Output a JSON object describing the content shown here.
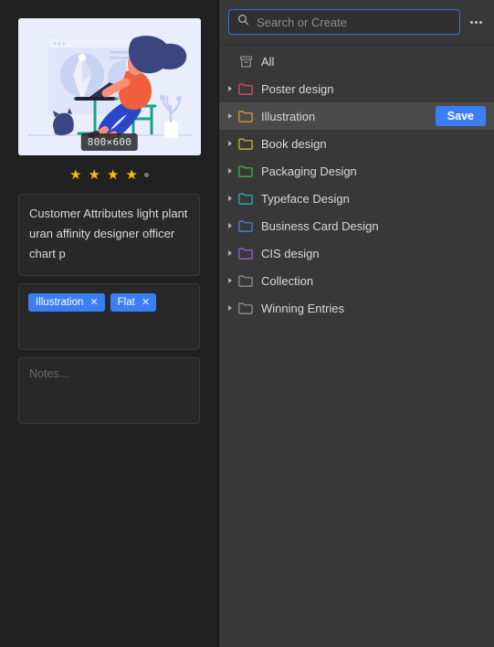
{
  "left": {
    "thumbnail": {
      "name": "preview-thumbnail",
      "dimensions_badge": "800×600",
      "alt": "flat illustration of a person with navy hair in an orange shirt sitting on a stool working on a laptop, browser window with pen-tool and pie chart behind, a cat and a potted plant nearby"
    },
    "rating": {
      "name": "star-rating",
      "filled": 4,
      "total": 4,
      "filled_color": "#fbb912",
      "has_clear_dot": true
    },
    "description": {
      "label": "description",
      "value": "Customer Attributes light plant uran affinity designer officer chart p"
    },
    "tags": {
      "label": "tags",
      "items": [
        {
          "label": "Illustration",
          "remove_glyph": "✕"
        },
        {
          "label": "Flat",
          "remove_glyph": "✕"
        }
      ],
      "tag_color": "#3b7ef6"
    },
    "notes": {
      "label": "notes",
      "value": "",
      "placeholder": "Notes..."
    }
  },
  "right": {
    "search": {
      "placeholder": "Search or Create",
      "value": "",
      "icon": "search-icon",
      "focused": true,
      "focus_color": "#3c6fe0"
    },
    "more_menu": {
      "name": "more-options-button",
      "icon": "ellipsis-icon"
    },
    "folders": [
      {
        "label": "All",
        "icon": "archive-box-icon",
        "color": "#9a9a9a",
        "twisty": false,
        "selected": false,
        "action": null
      },
      {
        "label": "Poster design",
        "icon": "folder-icon",
        "color": "#e05263",
        "twisty": true,
        "selected": false,
        "action": null
      },
      {
        "label": "Illustration",
        "icon": "folder-icon",
        "color": "#e8a33d",
        "twisty": true,
        "selected": true,
        "action": "Save"
      },
      {
        "label": "Book design",
        "icon": "folder-icon",
        "color": "#d8c230",
        "twisty": true,
        "selected": false,
        "action": null
      },
      {
        "label": "Packaging Design",
        "icon": "folder-icon",
        "color": "#3fbf53",
        "twisty": true,
        "selected": false,
        "action": null
      },
      {
        "label": "Typeface Design",
        "icon": "folder-icon",
        "color": "#2fb6c4",
        "twisty": true,
        "selected": false,
        "action": null
      },
      {
        "label": "Business Card Design",
        "icon": "folder-icon",
        "color": "#4f8ae0",
        "twisty": true,
        "selected": false,
        "action": null
      },
      {
        "label": "CIS design",
        "icon": "folder-icon",
        "color": "#a766d8",
        "twisty": true,
        "selected": false,
        "action": null
      },
      {
        "label": "Collection",
        "icon": "folder-icon",
        "color": "#9a9a9a",
        "twisty": true,
        "selected": false,
        "action": null
      },
      {
        "label": "Winning Entries",
        "icon": "folder-icon",
        "color": "#9a9a9a",
        "twisty": true,
        "selected": false,
        "action": null
      }
    ],
    "save_button_label": "Save",
    "save_button_color": "#3b7ef6"
  },
  "theme": {
    "left_bg": "#212121",
    "right_bg": "#383838",
    "row_selected_bg": "#4a4a4a",
    "accent": "#3b7ef6"
  }
}
